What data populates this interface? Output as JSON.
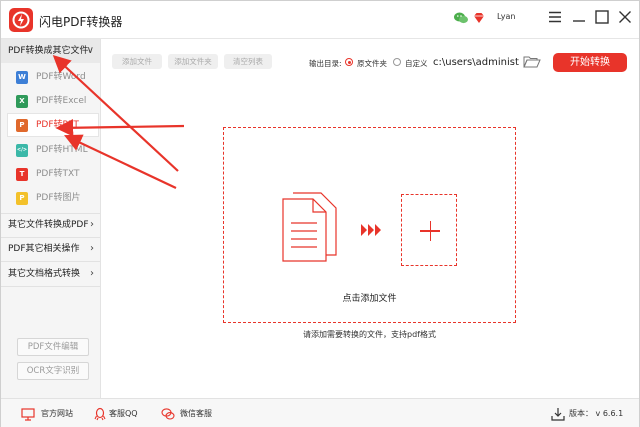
{
  "app": {
    "title": "闪电PDF转换器",
    "user_name": "Lyan",
    "version_label": "版本：",
    "version": "v 6.6.1",
    "accent_color": "#e8342a"
  },
  "sidebar": {
    "sections": [
      {
        "label": "PDF转换成其它文件",
        "chevron": "∨",
        "expanded": true
      },
      {
        "label": "其它文件转换成PDF",
        "chevron": "›",
        "expanded": false
      },
      {
        "label": "PDF其它相关操作",
        "chevron": "›",
        "expanded": false
      },
      {
        "label": "其它文档格式转换",
        "chevron": "›",
        "expanded": false
      }
    ],
    "items": [
      {
        "label": "PDF转Word",
        "icon_letter": "W",
        "color": "#3d7fd6",
        "selected": false
      },
      {
        "label": "PDF转Excel",
        "icon_letter": "X",
        "color": "#2f9a5a",
        "selected": false
      },
      {
        "label": "PDF转PPT",
        "icon_letter": "P",
        "color": "#e0692c",
        "selected": true
      },
      {
        "label": "PDF转HTML",
        "icon_letter": "</>",
        "color": "#3bb8a8",
        "selected": false
      },
      {
        "label": "PDF转TXT",
        "icon_letter": "T",
        "color": "#e8342a",
        "selected": false
      },
      {
        "label": "PDF转图片",
        "icon_letter": "P",
        "color": "#f3c12a",
        "selected": false
      }
    ],
    "tools": [
      "PDF文件编辑",
      "OCR文字识别"
    ]
  },
  "toolbar": {
    "add_file": "添加文件",
    "add_folder": "添加文件夹",
    "clear_list": "清空列表",
    "output_label": "输出目录:",
    "option_source": "原文件夹",
    "option_custom": "自定义",
    "path_value": "c:\\users\\administ",
    "start": "开始转换"
  },
  "main": {
    "drop_label": "点击添加文件",
    "hint": "请添加需要转换的文件，支持pdf格式"
  },
  "footer": {
    "website": "官方网站",
    "qq": "客服QQ",
    "wechat": "微信客服"
  },
  "icons": {
    "titlebar": [
      "wechat-icon",
      "vip-diamond-icon",
      "menu-icon",
      "minimize-icon",
      "maximize-icon",
      "close-icon"
    ],
    "footer": [
      "monitor-icon",
      "qq-icon",
      "wechat-icon",
      "download-icon"
    ]
  }
}
